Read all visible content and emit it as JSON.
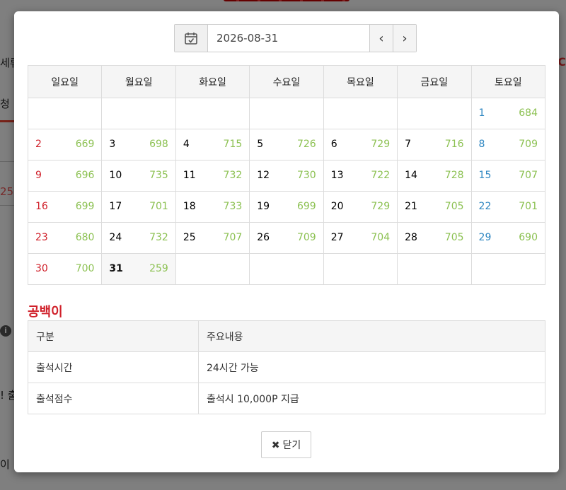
{
  "background": {
    "side_texts": [
      "세류",
      "청",
      "25",
      "! 출",
      "이"
    ]
  },
  "datebar": {
    "date_value": "2026-08-31",
    "prev_label": "‹",
    "next_label": "›"
  },
  "calendar": {
    "weekdays": [
      "일요일",
      "월요일",
      "화요일",
      "수요일",
      "목요일",
      "금요일",
      "토요일"
    ],
    "weeks": [
      [
        {
          "day": "",
          "count": ""
        },
        {
          "day": "",
          "count": ""
        },
        {
          "day": "",
          "count": ""
        },
        {
          "day": "",
          "count": ""
        },
        {
          "day": "",
          "count": ""
        },
        {
          "day": "",
          "count": ""
        },
        {
          "day": "1",
          "count": "684"
        }
      ],
      [
        {
          "day": "2",
          "count": "669"
        },
        {
          "day": "3",
          "count": "698"
        },
        {
          "day": "4",
          "count": "715"
        },
        {
          "day": "5",
          "count": "726"
        },
        {
          "day": "6",
          "count": "729"
        },
        {
          "day": "7",
          "count": "716"
        },
        {
          "day": "8",
          "count": "709"
        }
      ],
      [
        {
          "day": "9",
          "count": "696"
        },
        {
          "day": "10",
          "count": "735"
        },
        {
          "day": "11",
          "count": "732"
        },
        {
          "day": "12",
          "count": "730"
        },
        {
          "day": "13",
          "count": "722"
        },
        {
          "day": "14",
          "count": "728"
        },
        {
          "day": "15",
          "count": "707"
        }
      ],
      [
        {
          "day": "16",
          "count": "699"
        },
        {
          "day": "17",
          "count": "701"
        },
        {
          "day": "18",
          "count": "733"
        },
        {
          "day": "19",
          "count": "699"
        },
        {
          "day": "20",
          "count": "729"
        },
        {
          "day": "21",
          "count": "705"
        },
        {
          "day": "22",
          "count": "701"
        }
      ],
      [
        {
          "day": "23",
          "count": "680"
        },
        {
          "day": "24",
          "count": "732"
        },
        {
          "day": "25",
          "count": "707"
        },
        {
          "day": "26",
          "count": "709"
        },
        {
          "day": "27",
          "count": "704"
        },
        {
          "day": "28",
          "count": "705"
        },
        {
          "day": "29",
          "count": "690"
        }
      ],
      [
        {
          "day": "30",
          "count": "700"
        },
        {
          "day": "31",
          "count": "259"
        },
        {
          "day": "",
          "count": ""
        },
        {
          "day": "",
          "count": ""
        },
        {
          "day": "",
          "count": ""
        },
        {
          "day": "",
          "count": ""
        },
        {
          "day": "",
          "count": ""
        }
      ]
    ],
    "today": "31"
  },
  "section_title": "공백이",
  "info_table": {
    "headers": [
      "구분",
      "주요내용"
    ],
    "rows": [
      [
        "출석시간",
        "24시간 가능"
      ],
      [
        "출석점수",
        "출석시 10,000P 지급"
      ]
    ]
  },
  "close_button": {
    "icon": "✖",
    "label": "닫기"
  },
  "colors": {
    "sunday": "#d0202a",
    "saturday": "#2e86c1",
    "count": "#8cc152"
  }
}
